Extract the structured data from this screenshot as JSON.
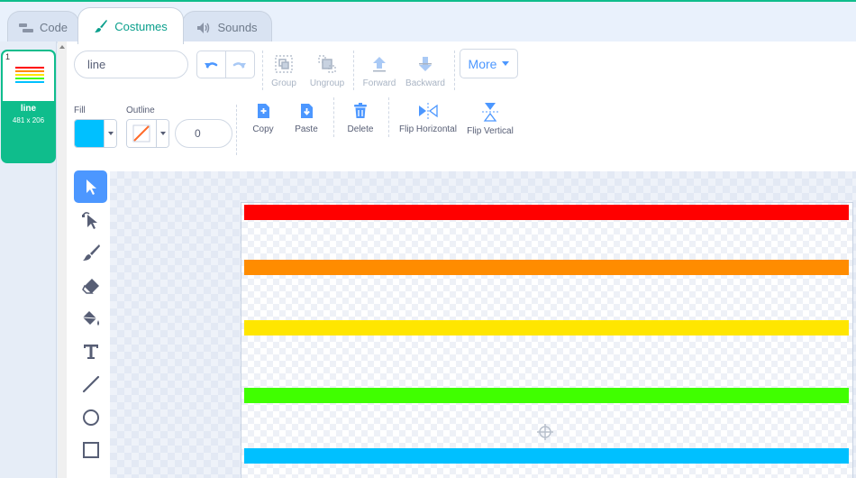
{
  "tabs": [
    {
      "label": "Code",
      "icon": "code-icon",
      "active": false
    },
    {
      "label": "Costumes",
      "icon": "brush-icon",
      "active": true
    },
    {
      "label": "Sounds",
      "icon": "speaker-icon",
      "active": false
    }
  ],
  "costume_list": {
    "items": [
      {
        "number": "1",
        "name": "line",
        "size": "481 x 206",
        "selected": true
      }
    ]
  },
  "editor": {
    "costume_name": "line",
    "buttons": {
      "group": "Group",
      "ungroup": "Ungroup",
      "forward": "Forward",
      "backward": "Backward",
      "more": "More",
      "copy": "Copy",
      "paste": "Paste",
      "delete": "Delete",
      "flip_horizontal": "Flip Horizontal",
      "flip_vertical": "Flip Vertical"
    },
    "fill": {
      "label": "Fill",
      "color": "#00c0ff"
    },
    "outline": {
      "label": "Outline",
      "color": "none",
      "width": "0"
    },
    "tools": [
      "select-icon",
      "reshape-icon",
      "brush-icon",
      "eraser-icon",
      "fill-bucket-icon",
      "text-icon",
      "line-icon",
      "circle-icon",
      "rectangle-icon"
    ],
    "active_tool": "select-icon"
  },
  "canvas": {
    "lines": [
      {
        "color": "#ff0000"
      },
      {
        "color": "#ff8c00"
      },
      {
        "color": "#ffe600"
      },
      {
        "color": "#40ff00"
      },
      {
        "color": "#00c0ff"
      }
    ]
  },
  "colors": {
    "accent": "#0fbd8c",
    "primary_blue": "#4c97ff"
  }
}
